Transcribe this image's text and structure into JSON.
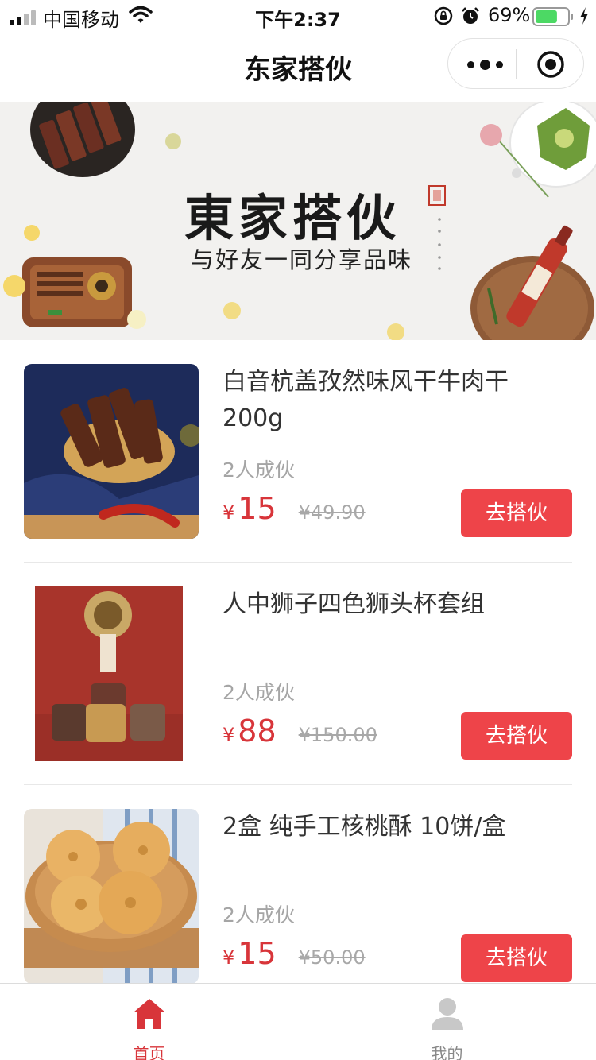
{
  "status_bar": {
    "carrier": "中国移动",
    "time": "下午2:37",
    "battery_percent": "69%",
    "battery_level": 0.69,
    "icons": [
      "signal-icon",
      "wifi-icon",
      "lock-rotation-icon",
      "alarm-icon",
      "battery-icon",
      "charging-icon"
    ]
  },
  "nav": {
    "title": "东家搭伙",
    "capsule_icons": [
      "more-icon",
      "close-icon"
    ]
  },
  "banner": {
    "title": "東家搭伙",
    "subtitle": "与好友一同分享品味"
  },
  "products": [
    {
      "name": "白音杭盖孜然味风干牛肉干200g",
      "group_size": "2人成伙",
      "currency": "¥",
      "price": "15",
      "original_price": "¥49.90",
      "button": "去搭伙",
      "image": "beef-jerky-image"
    },
    {
      "name": "人中狮子四色狮头杯套组",
      "group_size": "2人成伙",
      "currency": "¥",
      "price": "88",
      "original_price": "¥150.00",
      "button": "去搭伙",
      "image": "lion-cup-set-image"
    },
    {
      "name": "2盒 纯手工核桃酥 10饼/盒",
      "group_size": "2人成伙",
      "currency": "¥",
      "price": "15",
      "original_price": "¥50.00",
      "button": "去搭伙",
      "image": "walnut-cookie-image"
    }
  ],
  "tabs": [
    {
      "label": "首页",
      "icon": "home-icon",
      "active": true
    },
    {
      "label": "我的",
      "icon": "user-icon",
      "active": false
    }
  ],
  "colors": {
    "accent": "#d8353a",
    "button": "#ee4449",
    "muted": "#a5a5a5"
  }
}
